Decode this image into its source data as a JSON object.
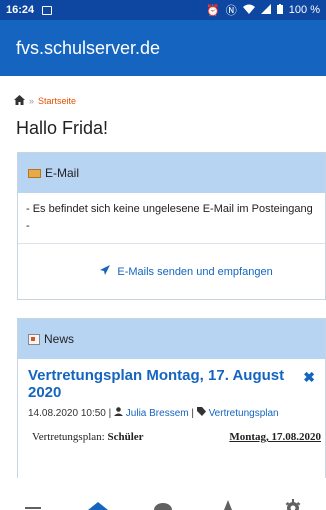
{
  "status_bar": {
    "time": "16:24",
    "battery": "100 %"
  },
  "app_bar": {
    "title": "fvs.schulserver.de"
  },
  "breadcrumb": {
    "separator": "»",
    "current": "Startseite"
  },
  "greeting": "Hallo Frida!",
  "email_card": {
    "title": "E-Mail",
    "message": "- Es befindet sich keine ungelesene E-Mail im Posteingang -",
    "action_label": "E-Mails senden und empfangen"
  },
  "news_card": {
    "title": "News",
    "article": {
      "title": "Vertretungsplan Montag, 17. August 2020",
      "datetime": "14.08.2020 10:50 |",
      "author": "Julia Bressem",
      "meta_separator": "|",
      "tag": "Vertretungsplan",
      "row_label_prefix": "Vertretungsplan: ",
      "row_label_bold": "Schüler",
      "row_date": "Montag, 17.08.2020"
    }
  },
  "bottom_nav": {
    "items": [
      "menu-icon",
      "home-icon",
      "chat-icon",
      "bell-icon",
      "settings-icon"
    ],
    "active_index": 1
  },
  "colors": {
    "status_bar": "#0d47a1",
    "app_bar": "#1565c0",
    "card_header": "#b8d4f3",
    "link": "#1565c0",
    "breadcrumb": "#e65100"
  }
}
